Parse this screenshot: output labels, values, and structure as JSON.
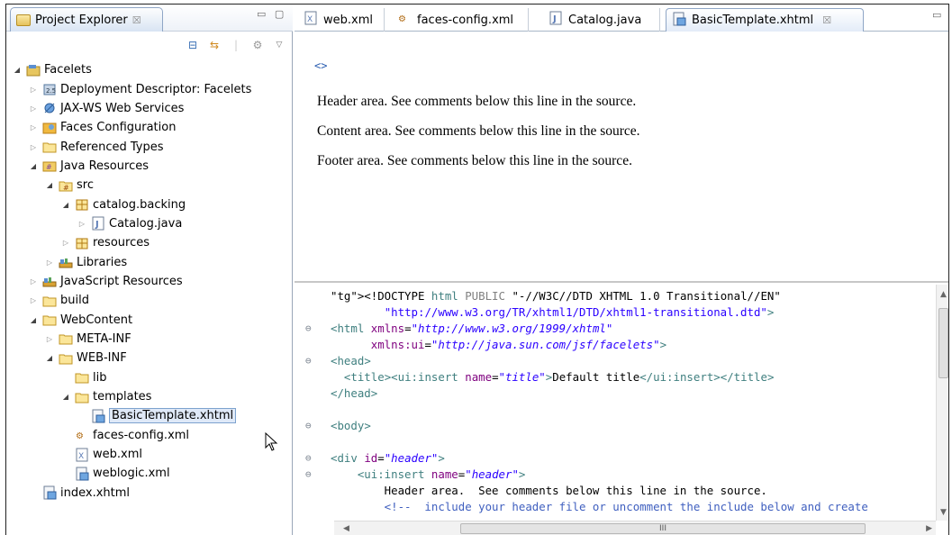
{
  "project_explorer": {
    "title": "Project Explorer",
    "close": "☒",
    "tree": [
      {
        "label": "Facelets",
        "depth": 0,
        "tw": "◢",
        "icon": "project-icon"
      },
      {
        "label": "Deployment Descriptor: Facelets",
        "depth": 1,
        "tw": "▷",
        "icon": "descriptor-icon"
      },
      {
        "label": "JAX-WS Web Services",
        "depth": 1,
        "tw": "▷",
        "icon": "webservices-icon"
      },
      {
        "label": "Faces Configuration",
        "depth": 1,
        "tw": "▷",
        "icon": "faces-config-icon"
      },
      {
        "label": "Referenced Types",
        "depth": 1,
        "tw": "▷",
        "icon": "folder-icon"
      },
      {
        "label": "Java Resources",
        "depth": 1,
        "tw": "◢",
        "icon": "java-resources-icon"
      },
      {
        "label": "src",
        "depth": 2,
        "tw": "◢",
        "icon": "source-folder-icon"
      },
      {
        "label": "catalog.backing",
        "depth": 3,
        "tw": "◢",
        "icon": "package-icon"
      },
      {
        "label": "Catalog.java",
        "depth": 4,
        "tw": "▷",
        "icon": "java-file-icon"
      },
      {
        "label": "resources",
        "depth": 3,
        "tw": "▷",
        "icon": "package-icon"
      },
      {
        "label": "Libraries",
        "depth": 2,
        "tw": "▷",
        "icon": "library-icon"
      },
      {
        "label": "JavaScript Resources",
        "depth": 1,
        "tw": "▷",
        "icon": "library-icon"
      },
      {
        "label": "build",
        "depth": 1,
        "tw": "▷",
        "icon": "folder-icon"
      },
      {
        "label": "WebContent",
        "depth": 1,
        "tw": "◢",
        "icon": "folder-icon"
      },
      {
        "label": "META-INF",
        "depth": 2,
        "tw": "▷",
        "icon": "folder-icon"
      },
      {
        "label": "WEB-INF",
        "depth": 2,
        "tw": "◢",
        "icon": "folder-icon"
      },
      {
        "label": "lib",
        "depth": 3,
        "tw": "",
        "icon": "folder-icon"
      },
      {
        "label": "templates",
        "depth": 3,
        "tw": "◢",
        "icon": "folder-icon"
      },
      {
        "label": "BasicTemplate.xhtml",
        "depth": 4,
        "tw": "",
        "icon": "xhtml-file-icon",
        "selected": true
      },
      {
        "label": "faces-config.xml",
        "depth": 3,
        "tw": "",
        "icon": "faces-xml-icon"
      },
      {
        "label": "web.xml",
        "depth": 3,
        "tw": "",
        "icon": "xml-file-icon"
      },
      {
        "label": "weblogic.xml",
        "depth": 3,
        "tw": "",
        "icon": "xhtml-file-icon"
      },
      {
        "label": "index.xhtml",
        "depth": 1,
        "tw": "",
        "icon": "xhtml-file-icon"
      }
    ]
  },
  "editor": {
    "tabs": [
      {
        "label": "web.xml",
        "icon": "xml-file-icon"
      },
      {
        "label": "faces-config.xml",
        "icon": "faces-xml-icon"
      },
      {
        "label": "Catalog.java",
        "icon": "java-file-icon"
      },
      {
        "label": "BasicTemplate.xhtml",
        "icon": "xhtml-file-icon",
        "active": true,
        "close": "☒"
      }
    ],
    "design": {
      "tag_marker": "<>",
      "paragraphs": [
        "Header area. See comments below this line in the source.",
        "Content area. See comments below this line in the source.",
        "Footer area. See comments below this line in the source."
      ]
    },
    "source_lines": [
      "<!DOCTYPE html PUBLIC \"-//W3C//DTD XHTML 1.0 Transitional//EN\"",
      "        \"http://www.w3.org/TR/xhtml1/DTD/xhtml1-transitional.dtd\">",
      "<html xmlns=\"http://www.w3.org/1999/xhtml\"",
      "      xmlns:ui=\"http://java.sun.com/jsf/facelets\">",
      "<head>",
      "  <title><ui:insert name=\"title\">Default title</ui:insert></title>",
      "</head>",
      "",
      "<body>",
      "",
      "<div id=\"header\">",
      "    <ui:insert name=\"header\">",
      "        Header area.  See comments below this line in the source.",
      "        <!--  include your header file or uncomment the include below and create"
    ],
    "hscroll_grip": "III"
  }
}
